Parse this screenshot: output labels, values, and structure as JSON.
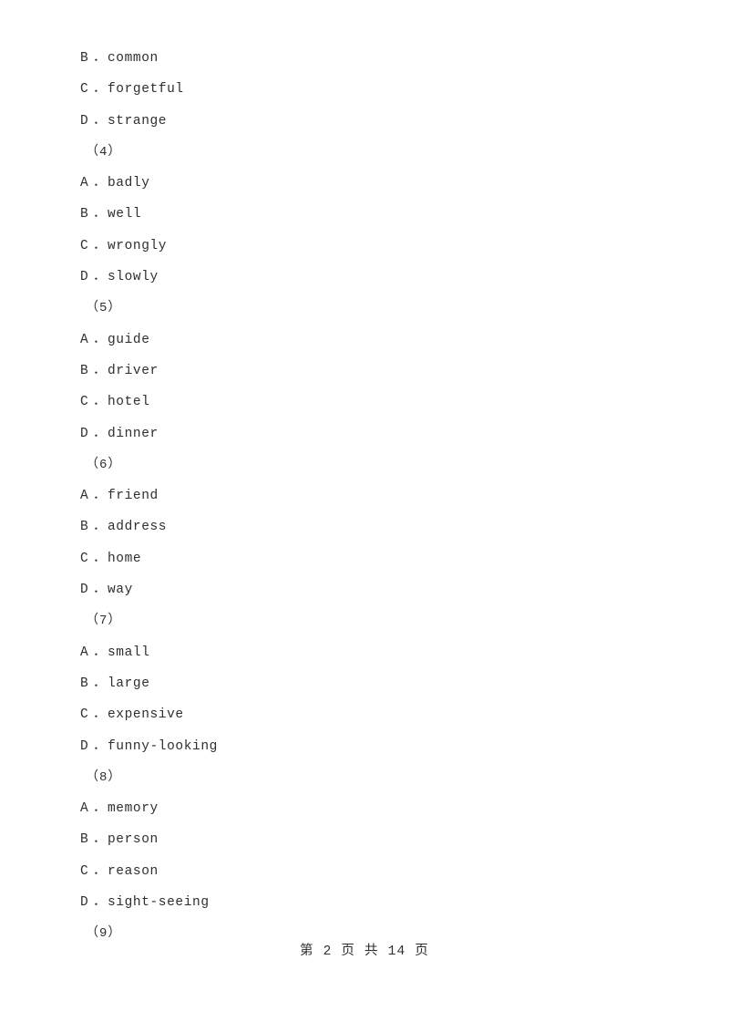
{
  "document": {
    "page_background": "#ffffff",
    "text_color": "#2f2f2f"
  },
  "body_lines": [
    {
      "kind": "option",
      "letter": "B",
      "separator": "．",
      "text": "common"
    },
    {
      "kind": "option",
      "letter": "C",
      "separator": "．",
      "text": "forgetful"
    },
    {
      "kind": "option",
      "letter": "D",
      "separator": "．",
      "text": "strange"
    },
    {
      "kind": "question",
      "label": "（4）"
    },
    {
      "kind": "option",
      "letter": "A",
      "separator": "．",
      "text": "badly"
    },
    {
      "kind": "option",
      "letter": "B",
      "separator": "．",
      "text": "well"
    },
    {
      "kind": "option",
      "letter": "C",
      "separator": "．",
      "text": "wrongly"
    },
    {
      "kind": "option",
      "letter": "D",
      "separator": "．",
      "text": "slowly"
    },
    {
      "kind": "question",
      "label": "（5）"
    },
    {
      "kind": "option",
      "letter": "A",
      "separator": "．",
      "text": "guide"
    },
    {
      "kind": "option",
      "letter": "B",
      "separator": "．",
      "text": "driver"
    },
    {
      "kind": "option",
      "letter": "C",
      "separator": "．",
      "text": "hotel"
    },
    {
      "kind": "option",
      "letter": "D",
      "separator": "．",
      "text": "dinner"
    },
    {
      "kind": "question",
      "label": "（6）"
    },
    {
      "kind": "option",
      "letter": "A",
      "separator": "．",
      "text": "friend"
    },
    {
      "kind": "option",
      "letter": "B",
      "separator": "．",
      "text": "address"
    },
    {
      "kind": "option",
      "letter": "C",
      "separator": "．",
      "text": "home"
    },
    {
      "kind": "option",
      "letter": "D",
      "separator": "．",
      "text": "way"
    },
    {
      "kind": "question",
      "label": "（7）"
    },
    {
      "kind": "option",
      "letter": "A",
      "separator": "．",
      "text": "small"
    },
    {
      "kind": "option",
      "letter": "B",
      "separator": "．",
      "text": "large"
    },
    {
      "kind": "option",
      "letter": "C",
      "separator": "．",
      "text": "expensive"
    },
    {
      "kind": "option",
      "letter": "D",
      "separator": "．",
      "text": "funny-looking"
    },
    {
      "kind": "question",
      "label": "（8）"
    },
    {
      "kind": "option",
      "letter": "A",
      "separator": "．",
      "text": "memory"
    },
    {
      "kind": "option",
      "letter": "B",
      "separator": "．",
      "text": "person"
    },
    {
      "kind": "option",
      "letter": "C",
      "separator": "．",
      "text": "reason"
    },
    {
      "kind": "option",
      "letter": "D",
      "separator": "．",
      "text": "sight-seeing"
    },
    {
      "kind": "question",
      "label": "（9）"
    }
  ],
  "footer": {
    "text": "第 2 页 共 14 页",
    "current_page": "2",
    "total_pages": "14"
  }
}
